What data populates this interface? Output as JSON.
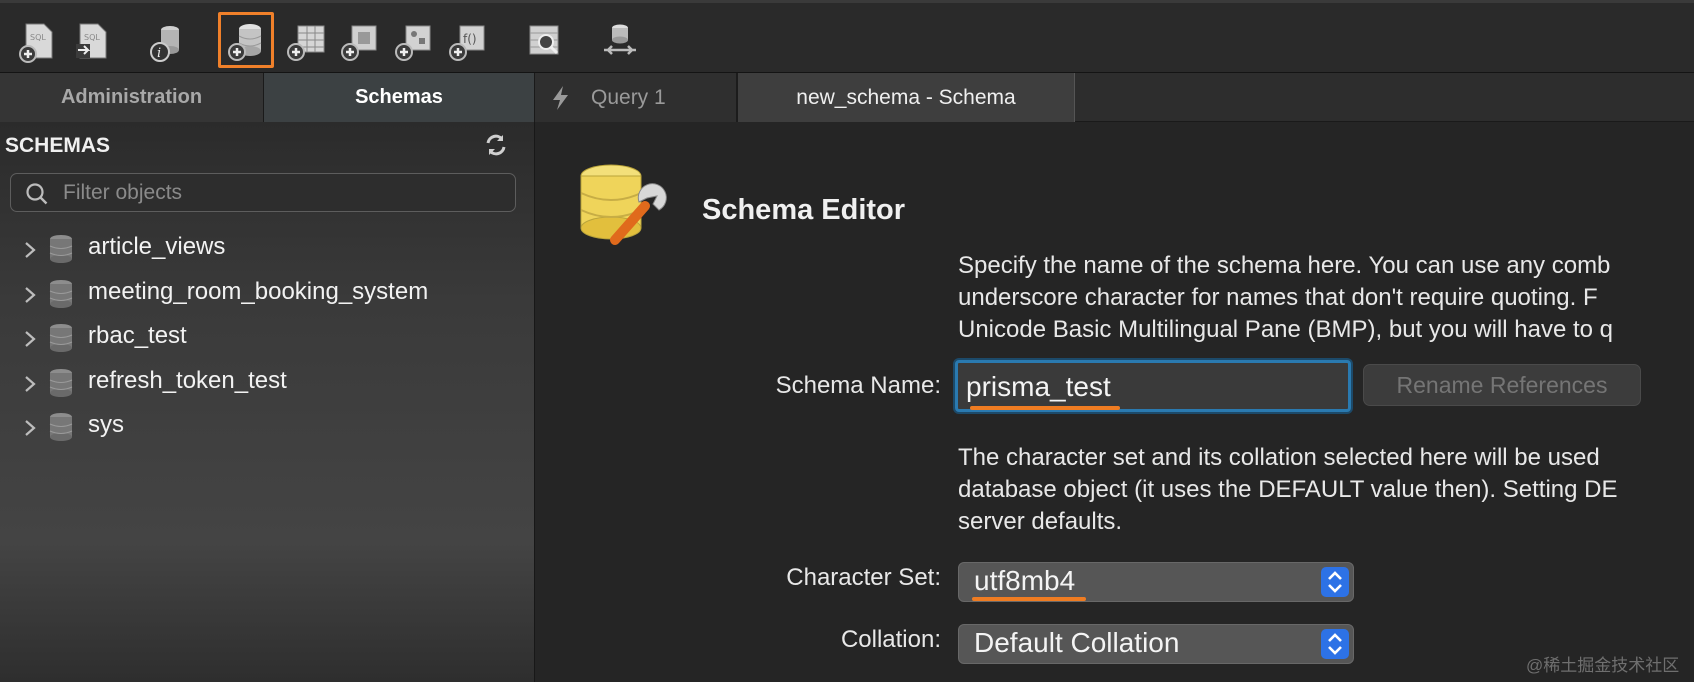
{
  "toolbar": {
    "buttons": [
      {
        "name": "new-sql-tab-icon"
      },
      {
        "name": "open-sql-script-icon"
      },
      {
        "name": "server-info-icon"
      },
      {
        "name": "create-schema-icon",
        "active": true
      },
      {
        "name": "create-table-icon"
      },
      {
        "name": "create-view-icon"
      },
      {
        "name": "create-procedure-icon"
      },
      {
        "name": "create-function-icon"
      },
      {
        "name": "search-table-data-icon"
      },
      {
        "name": "reconnect-icon"
      }
    ],
    "active_color": "#f0802a"
  },
  "sidebar": {
    "tabs": [
      "Administration",
      "Schemas"
    ],
    "active_tab": "Schemas",
    "header": "SCHEMAS",
    "search_placeholder": "Filter objects",
    "schemas": [
      "article_views",
      "meeting_room_booking_system",
      "rbac_test",
      "refresh_token_test",
      "sys"
    ]
  },
  "doc_tabs": {
    "query": "Query 1",
    "schema": "new_schema - Schema",
    "active": "new_schema - Schema"
  },
  "editor": {
    "title": "Schema Editor",
    "intro_lines": [
      "Specify the name of the schema here. You can use any comb",
      "underscore character for names that don't require quoting. F",
      "Unicode Basic Multilingual Pane (BMP), but you will have to q"
    ],
    "name_label": "Schema Name:",
    "name_value": "prisma_test",
    "rename_button": "Rename References",
    "charset_lines": [
      "The character set and its collation selected here will be used",
      "database object (it uses the DEFAULT value then). Setting DE",
      "server defaults."
    ],
    "charset_label": "Character Set:",
    "charset_value": "utf8mb4",
    "collation_label": "Collation:",
    "collation_value": "Default Collation",
    "highlight_color": "#ef7c22"
  },
  "watermark": "@稀土掘金技术社区"
}
